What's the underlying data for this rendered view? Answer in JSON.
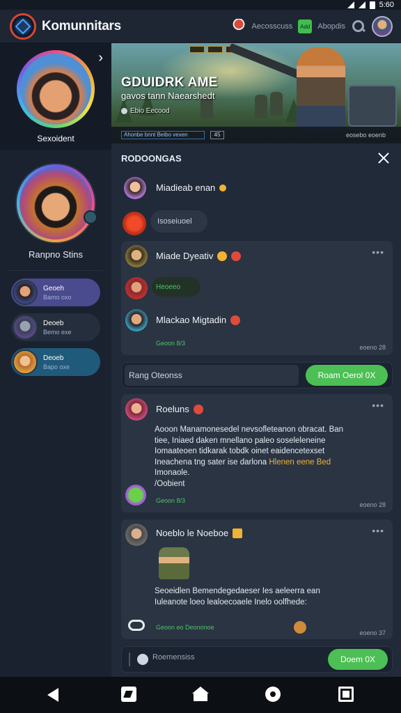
{
  "status": {
    "time": "5:60"
  },
  "appbar": {
    "title": "Komunnitars",
    "nav_link_1": "Aecosscuss",
    "nav_chip": "Add",
    "nav_link_2": "Abopdis"
  },
  "sidebar": {
    "hero_name": "Sexoident",
    "profile_name": "Ranpno Stins",
    "items": [
      {
        "title": "Geoeh",
        "sub": "Bamo oxo"
      },
      {
        "title": "Deoeb",
        "sub": "Bemo exe"
      },
      {
        "title": "Deoeb",
        "sub": "Bapo oxe"
      }
    ]
  },
  "banner": {
    "title": "GDUIDRK  AME",
    "subtitle": "gavos tann Naearshedt",
    "meta": "Ebio Eecood",
    "bar_label": "Ahonbe bnnt Beibo vexen",
    "count": "45",
    "right_meta": "eosebo eoenb"
  },
  "main": {
    "section_title": "RODOONGAS",
    "msg1": {
      "name": "Miadieab enan"
    },
    "pill": {
      "label": "Isoseiuoel"
    },
    "card1": {
      "msg_a": {
        "name": "Miade Dyeativ"
      },
      "green_pill": "Heoeeo",
      "msg_b": {
        "name": "Mlackao Migtadin"
      },
      "green_meta": "Geoon 8/3",
      "time": "eoeno 28"
    },
    "reply1": {
      "placeholder": "Rang Oteonss",
      "button": "Roam Oerol 0X"
    },
    "card2": {
      "name": "Roeluns",
      "text_1": "Aooon  Manamonesedel nevsofleteanon obracat. Ban",
      "text_2": "tiee, Iniaed daken mnellano paleo soseleleneine",
      "text_3": "Iomaateoen tidkarak tobdk oinet eaidencetexset",
      "text_4_plain": "Ineachena tng sater ise darlona",
      "text_4_highlight": "Hlenen eene Bed",
      "text_5": "Imonaole.",
      "text_6": "/Oobient",
      "green_meta": "Geoon 8/3",
      "time": "eoeno 28"
    },
    "card3": {
      "name": "Noeblo le Noeboe",
      "text_1": "Seoeidlen Bemendegedaeser Ies aeleerra ean",
      "text_2": "Iuleanote loeo lealoecoaele Inelo oolfhede:",
      "green_meta": "Geoon eo Deononoe",
      "time": "eoeno 37"
    },
    "reply2": {
      "placeholder": "Roemensiss",
      "button": "Doem 0X"
    }
  },
  "colors": {
    "accent_green": "#4cbf55",
    "highlight": "#f2b233",
    "background": "#1b2330"
  },
  "icons": [
    "logo-icon",
    "search-icon",
    "close-icon",
    "more-dots-icon",
    "back-icon",
    "home-icon",
    "recents-icon"
  ]
}
